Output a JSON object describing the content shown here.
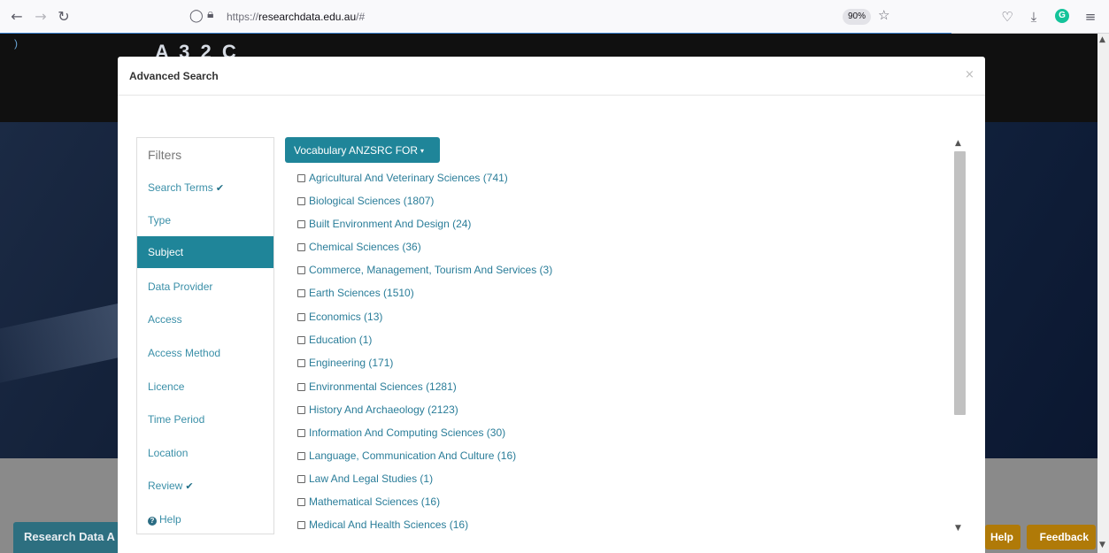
{
  "browser": {
    "url_prefix": "https://",
    "url_domain": "researchdata.edu.au",
    "url_suffix": "/#",
    "zoom": "90%",
    "back_icon": "back-arrow-icon",
    "forward_icon": "forward-arrow-icon",
    "reload_icon": "reload-icon"
  },
  "page": {
    "logo_fragment": "A 3 2 C",
    "rda_button": "Research Data A",
    "help_tab": "Help",
    "feedback_tab": "Feedback"
  },
  "modal": {
    "title": "Advanced Search",
    "close": "×",
    "filters_title": "Filters",
    "filters": [
      {
        "label": "Search Terms",
        "checked": true
      },
      {
        "label": "Type",
        "checked": false
      },
      {
        "label": "Subject",
        "checked": false,
        "active": true
      },
      {
        "label": "Data Provider",
        "checked": false
      },
      {
        "label": "Access",
        "checked": false
      },
      {
        "label": "Access Method",
        "checked": false
      },
      {
        "label": "Licence",
        "checked": false
      },
      {
        "label": "Time Period",
        "checked": false
      },
      {
        "label": "Location",
        "checked": false
      },
      {
        "label": "Review",
        "checked": true
      },
      {
        "label": "Help",
        "checked": false
      }
    ],
    "vocab_button": "Vocabulary ANZSRC FOR",
    "subjects": [
      "Agricultural And Veterinary Sciences (741)",
      "Biological Sciences (1807)",
      "Built Environment And Design (24)",
      "Chemical Sciences (36)",
      "Commerce, Management, Tourism And Services (3)",
      "Earth Sciences (1510)",
      "Economics (13)",
      "Education (1)",
      "Engineering (171)",
      "Environmental Sciences (1281)",
      "History And Archaeology (2123)",
      "Information And Computing Sciences (30)",
      "Language, Communication And Culture (16)",
      "Law And Legal Studies (1)",
      "Mathematical Sciences (16)",
      "Medical And Health Sciences (16)"
    ]
  },
  "colors": {
    "accent": "#1f8599",
    "link": "#2a7d99",
    "feedback": "#b07a08"
  }
}
